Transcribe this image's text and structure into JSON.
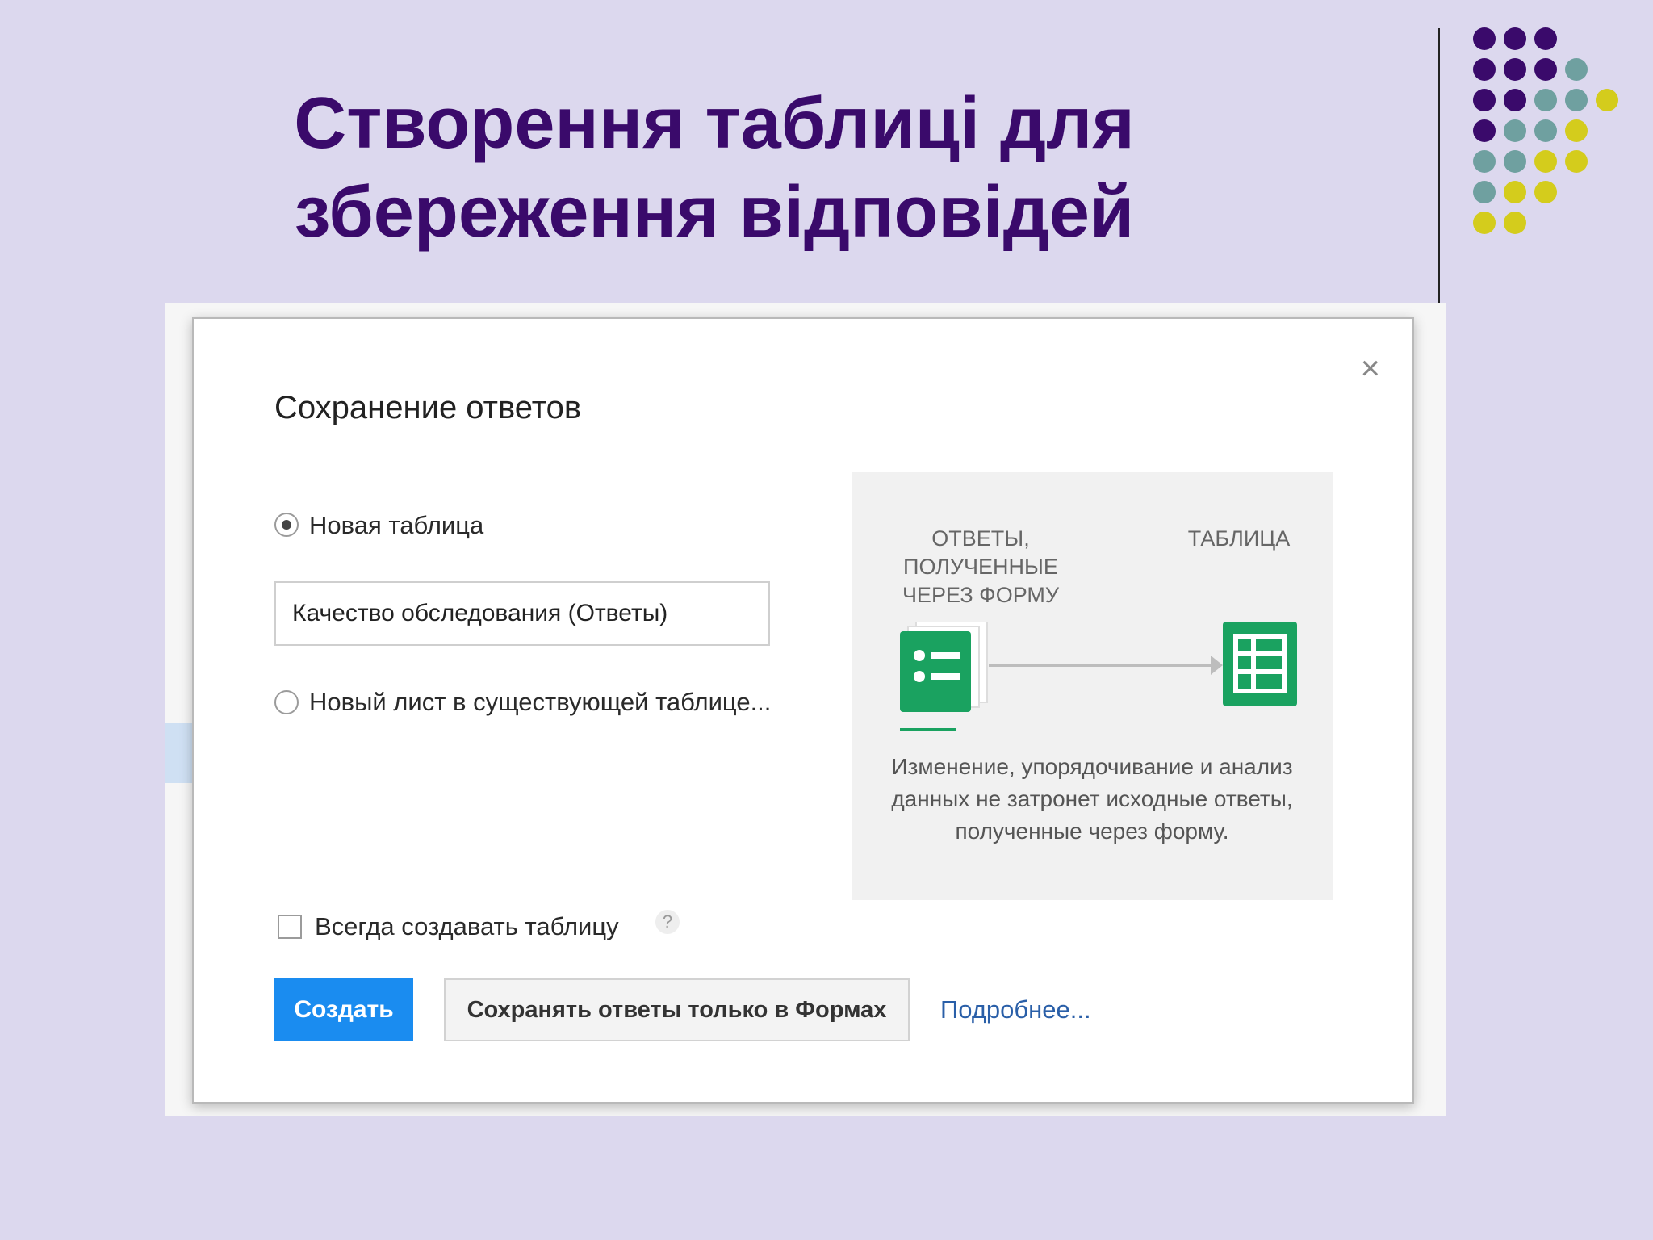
{
  "slide": {
    "title_line1": "Створення таблиці для",
    "title_line2": "збереження відповідей"
  },
  "dialog": {
    "title": "Сохранение ответов",
    "close": "×",
    "options": [
      {
        "label": "Новая таблица",
        "selected": true
      },
      {
        "label": "Новый лист в существующей таблице...",
        "selected": false
      }
    ],
    "table_name_value": "Качество обследования (Ответы)",
    "always_create_label": "Всегда создавать таблицу",
    "always_create_checked": false,
    "help": "?",
    "create_button": "Создать",
    "forms_only_button": "Сохранять ответы только в Формах",
    "more_link": "Подробнее...",
    "info": {
      "left_heading": [
        "ОТВЕТЫ,",
        "ПОЛУЧЕННЫЕ",
        "ЧЕРЕЗ ФОРМУ"
      ],
      "right_heading": "ТАБЛИЦА",
      "description": "Изменение, упорядочивание и анализ данных не затронет исходные ответы, полученные через форму."
    }
  },
  "colors": {
    "title": "#3a0a6b",
    "dot_purple": "#3a0a6b",
    "dot_teal": "#6fa0a0",
    "dot_yellow": "#d4cc1c",
    "primary_button": "#1a8cf0",
    "green_icon": "#1aa260",
    "link": "#2a5fa8"
  },
  "icons": [
    "close-icon",
    "forms-icon",
    "arrow-right-icon",
    "spreadsheet-icon",
    "help-icon"
  ]
}
